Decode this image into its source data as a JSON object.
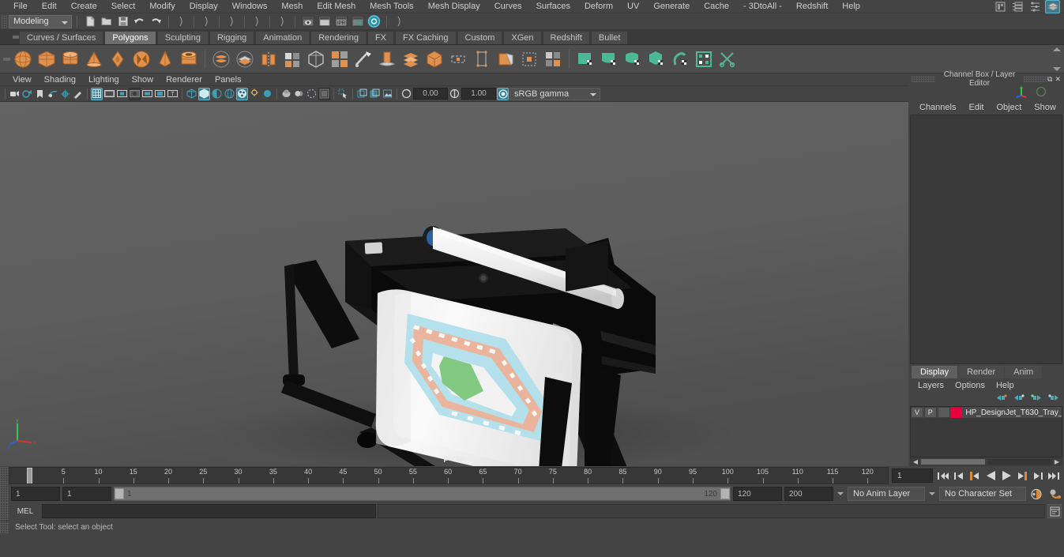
{
  "menubar": {
    "items": [
      "File",
      "Edit",
      "Create",
      "Select",
      "Modify",
      "Display",
      "Windows",
      "Mesh",
      "Edit Mesh",
      "Mesh Tools",
      "Mesh Display",
      "Curves",
      "Surfaces",
      "Deform",
      "UV",
      "Generate",
      "Cache",
      "- 3DtoAll -",
      "Redshift",
      "Help"
    ]
  },
  "statusbar": {
    "mode": "Modeling",
    "icons": [
      "new-scene-icon",
      "open-scene-icon",
      "save-scene-icon",
      "undo-icon",
      "redo-icon",
      "select-by-hierarchy-icon",
      "select-by-object-icon",
      "select-by-component-icon",
      "snap-grid-icon",
      "snap-curve-icon",
      "snap-point-icon",
      "snap-view-icon",
      "render-current-frame-icon",
      "ipr-render-icon",
      "render-settings-icon",
      "hypershade-icon",
      "render-view-icon"
    ]
  },
  "shelf": {
    "tabs": [
      {
        "label": "Curves / Surfaces",
        "active": false
      },
      {
        "label": "Polygons",
        "active": true
      },
      {
        "label": "Sculpting",
        "active": false
      },
      {
        "label": "Rigging",
        "active": false
      },
      {
        "label": "Animation",
        "active": false
      },
      {
        "label": "Rendering",
        "active": false
      },
      {
        "label": "FX",
        "active": false
      },
      {
        "label": "FX Caching",
        "active": false
      },
      {
        "label": "Custom",
        "active": false
      },
      {
        "label": "XGen",
        "active": false
      },
      {
        "label": "Redshift",
        "active": false
      },
      {
        "label": "Bullet",
        "active": false
      }
    ],
    "icons": [
      "poly-sphere-icon",
      "poly-cube-icon",
      "poly-cylinder-icon",
      "poly-cone-icon",
      "poly-torus-icon",
      "poly-prism-icon",
      "poly-pyramid-icon",
      "poly-pipe-icon",
      "poly-helix-icon",
      "poly-soccer-ball-icon",
      "poly-platonic-icon",
      "poly-type-icon",
      "poly-plane-icon",
      "poly-disc-icon",
      "poly-super-ellipse-icon",
      "combine-icon",
      "separate-icon",
      "booleans-icon",
      "mirror-icon",
      "smooth-icon",
      "extrude-icon",
      "bevel-icon",
      "bridge-icon",
      "merge-icon",
      "fill-hole-icon",
      "multi-cut-icon",
      "target-weld-icon",
      "quad-draw-icon",
      "sculpt-icon",
      "crease-icon"
    ]
  },
  "viewport": {
    "panel_menu": [
      "View",
      "Shading",
      "Lighting",
      "Show",
      "Renderer",
      "Panels"
    ],
    "camera_label": "persp",
    "exposure": "0.00",
    "gamma": "1.00",
    "color_space": "sRGB gamma",
    "toolbar_icons": [
      "select-camera-icon",
      "camera-attributes-icon",
      "bookmark-icon",
      "image-plane-icon",
      "two-d-pan-zoom-icon",
      "grease-pencil-icon",
      "grid-toggle-icon",
      "film-gate-icon",
      "resolution-gate-icon",
      "gate-mask-icon",
      "field-chart-icon",
      "safe-action-icon",
      "safe-title-icon",
      "wireframe-icon",
      "smooth-shade-icon",
      "shaded-wireframe-icon",
      "textured-icon",
      "use-all-lights-icon",
      "shadows-icon",
      "ambient-occlusion-icon",
      "motion-blur-icon",
      "multisample-icon",
      "isolate-select-icon",
      "xray-icon",
      "xray-joints-icon",
      "xray-active-components-icon",
      "exposure-icon",
      "gamma-icon",
      "view-transform-icon"
    ]
  },
  "channelbox": {
    "panel_title": "Channel Box / Layer Editor",
    "menus": [
      "Channels",
      "Edit",
      "Object",
      "Show"
    ]
  },
  "layereditor": {
    "tabs": [
      {
        "label": "Display",
        "active": true
      },
      {
        "label": "Render",
        "active": false
      },
      {
        "label": "Anim",
        "active": false
      }
    ],
    "menus": [
      "Layers",
      "Options",
      "Help"
    ],
    "buttons": [
      "layer-prev-icon",
      "layer-prev2-icon",
      "layer-next-icon",
      "layer-next2-icon"
    ],
    "layers": [
      {
        "visibility": "V",
        "playback": "P",
        "shading": "",
        "color": "#e8003c",
        "name": "HP_DesignJet_T630_Tray_"
      }
    ]
  },
  "timeline": {
    "ticks": [
      "5",
      "10",
      "15",
      "20",
      "25",
      "30",
      "35",
      "40",
      "45",
      "50",
      "55",
      "60",
      "65",
      "70",
      "75",
      "80",
      "85",
      "90",
      "95",
      "100",
      "105",
      "110",
      "115",
      "120"
    ],
    "current_frame": "1",
    "playback_buttons": [
      "go-to-start-icon",
      "step-back-frame-icon",
      "step-back-key-icon",
      "play-backwards-icon",
      "play-forwards-icon",
      "step-forward-key-icon",
      "step-forward-frame-icon",
      "go-to-end-icon"
    ]
  },
  "rangeslider": {
    "anim_start": "1",
    "range_start": "1",
    "slider_start_label": "1",
    "slider_end_label": "120",
    "range_end": "120",
    "anim_end": "200",
    "anim_layer": "No Anim Layer",
    "character_set": "No Character Set",
    "right_icons": [
      "auto-keyframe-icon",
      "animation-preferences-icon"
    ]
  },
  "commandline": {
    "language": "MEL",
    "input_value": "",
    "output_value": "",
    "script-editor-icon": "script-editor-icon"
  },
  "helpline": {
    "text": "Select Tool: select an object"
  },
  "titlebar_right": {
    "icons": [
      "modeling-toolkit-icon",
      "attribute-editor-icon",
      "channel-box-icon",
      "tool-settings-icon"
    ]
  },
  "colors": {
    "accent_teal": "#3f9fb5",
    "shelf_orange": "#e0914f",
    "shelf_green": "#4bb896",
    "layer_red": "#e8003c",
    "bg_main": "#444444",
    "viewport_bg": "#5b5b5b"
  }
}
